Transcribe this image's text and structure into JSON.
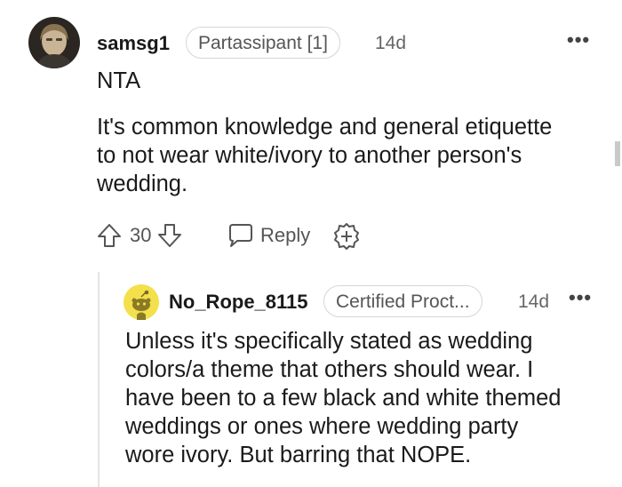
{
  "comment": {
    "username": "samsg1",
    "flair": "Partassipant [1]",
    "time": "14d",
    "more": "•••",
    "line1": "NTA",
    "line2": "It's common knowledge and general etiquette",
    "line3": "to not wear white/ivory to another person's",
    "line4": "wedding.",
    "votes": "30",
    "reply_label": "Reply"
  },
  "reply": {
    "username": "No_Rope_8115",
    "flair": "Certified Proct...",
    "time": "14d",
    "more": "•••",
    "lines": [
      "Unless it's specifically stated as wedding",
      "colors/a theme that others should wear. I",
      "have been to a few black and white themed",
      "weddings or ones where wedding party",
      "wore ivory. But barring that NOPE."
    ]
  },
  "icons": {
    "upvote": "upvote-arrow-icon",
    "downvote": "downvote-arrow-icon",
    "reply": "speech-bubble-icon",
    "award": "award-plus-icon",
    "snoo": "snoo-avatar-icon"
  }
}
